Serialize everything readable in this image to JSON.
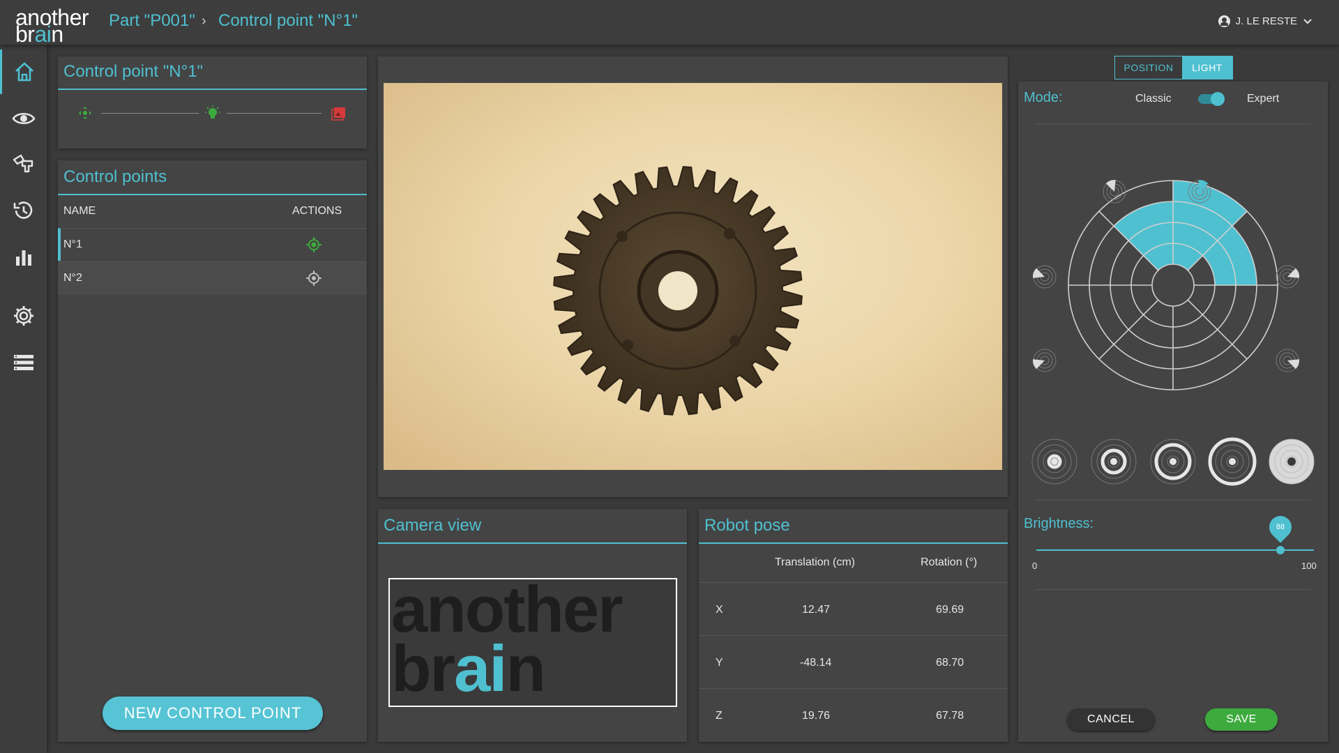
{
  "app": {
    "logo_line1": "another",
    "logo_line2_pre": "br",
    "logo_line2_ai": "ai",
    "logo_line2_post": "n"
  },
  "breadcrumb": {
    "part": "Part \"P001\"",
    "separator": "›",
    "control_point": "Control point \"N°1\""
  },
  "user": {
    "name": "J. LE RESTE",
    "icon": "account-circle-icon"
  },
  "sidebar": {
    "items": [
      {
        "icon": "home-icon",
        "active": true
      },
      {
        "icon": "eye-icon",
        "active": false
      },
      {
        "icon": "robot-arm-icon",
        "active": false
      },
      {
        "icon": "history-icon",
        "active": false
      },
      {
        "icon": "bar-chart-icon",
        "active": false
      },
      {
        "icon": "gear-icon",
        "active": false
      },
      {
        "icon": "list-icon",
        "active": false
      }
    ]
  },
  "control_point_panel": {
    "title": "Control point \"N°1\"",
    "steps": [
      {
        "icon": "move-icon",
        "color": "#3daa3d"
      },
      {
        "icon": "light-bulb-icon",
        "color": "#3daa3d"
      },
      {
        "icon": "image-icon",
        "color": "#d63b3b"
      }
    ]
  },
  "control_points": {
    "title": "Control points",
    "col_name": "NAME",
    "col_actions": "ACTIONS",
    "rows": [
      {
        "name": "N°1",
        "selected": true,
        "action_icon": "target-icon"
      },
      {
        "name": "N°2",
        "selected": false,
        "action_icon": "target-icon"
      }
    ],
    "new_button": "NEW CONTROL POINT"
  },
  "camera_view": {
    "title": "Camera view",
    "line1": "another",
    "line2_pre": "br",
    "line2_ai": "ai",
    "line2_post": "n"
  },
  "robot_pose": {
    "title": "Robot pose",
    "col_translation": "Translation (cm)",
    "col_rotation": "Rotation (°)",
    "rows": [
      {
        "axis": "X",
        "translation": "12.47",
        "rotation": "69.69"
      },
      {
        "axis": "Y",
        "translation": "-48.14",
        "rotation": "68.70"
      },
      {
        "axis": "Z",
        "translation": "19.76",
        "rotation": "67.78"
      }
    ]
  },
  "light_panel": {
    "tabs": [
      "POSITION",
      "LIGHT"
    ],
    "active_tab": "LIGHT",
    "mode_label": "Mode:",
    "mode_classic": "Classic",
    "mode_expert": "Expert",
    "expert_on": true,
    "brightness_label": "Brightness:",
    "brightness_value": "88",
    "brightness_min": "0",
    "brightness_max": "100",
    "cancel": "CANCEL",
    "save": "SAVE",
    "accent": "#4fc0d0"
  }
}
